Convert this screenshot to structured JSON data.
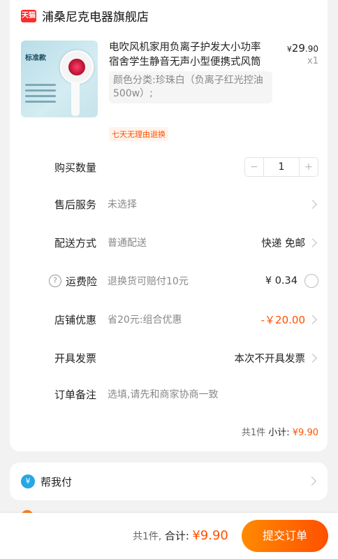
{
  "store": {
    "badge": "天猫",
    "name": "浦桑尼克电器旗舰店"
  },
  "product": {
    "image_tag": "标准款",
    "title": "电吹风机家用负离子护发大小功率宿舍学生静音无声小型便携式风筒",
    "sku": "颜色分类:珍珠白（负离子红光控油500w）;",
    "price_symbol": "¥",
    "price_int": "29",
    "price_dec": ".90",
    "quantity_label": "x1",
    "return_badge": "七天无理由退换"
  },
  "rows": {
    "quantity": {
      "label": "购买数量",
      "minus": "−",
      "value": "1",
      "plus": "+"
    },
    "after_sales": {
      "label": "售后服务",
      "value": "未选择"
    },
    "delivery": {
      "label": "配送方式",
      "value": "普通配送",
      "right": "快递 免邮"
    },
    "shipping_insurance": {
      "icon": "?",
      "label": "运费险",
      "value": "退换货可赔付10元",
      "right": "¥ 0.34"
    },
    "store_discount": {
      "label": "店铺优惠",
      "value": "省20元:组合优惠",
      "right": "-￥20.00"
    },
    "invoice": {
      "label": "开具发票",
      "right": "本次不开具发票"
    },
    "note": {
      "label": "订单备注",
      "placeholder": "选填,请先和商家协商一致"
    }
  },
  "subtotal": {
    "count": "共1件",
    "label": "小计:",
    "amount": "¥9.90"
  },
  "pay_for_me": {
    "icon": "¥",
    "label": "帮我付"
  },
  "footer": {
    "count": "共1件,",
    "label": "合计:",
    "amount": "¥9.90",
    "submit": "提交订单"
  },
  "colors": {
    "accent": "#ff5000",
    "tmall": "#ff2a2a",
    "pay_icon": "#24a7e6"
  }
}
